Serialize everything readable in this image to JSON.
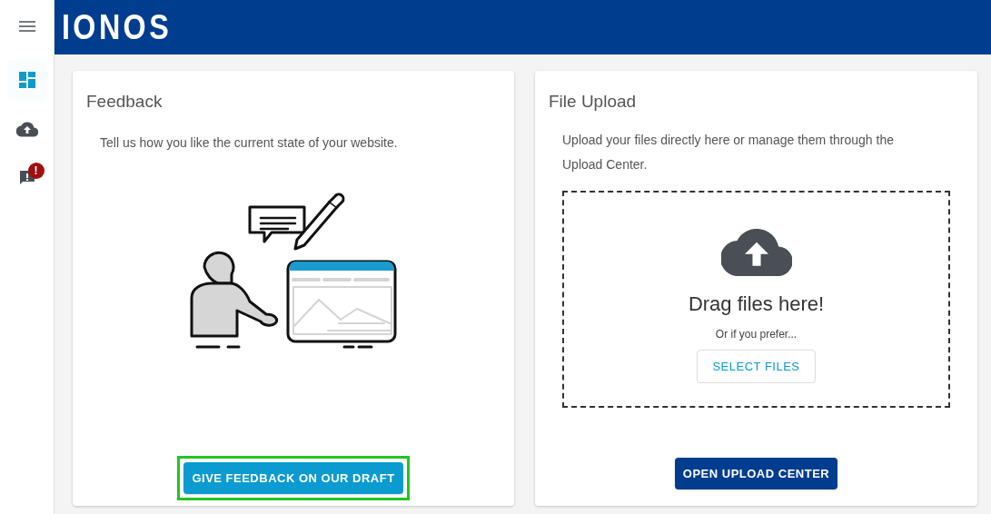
{
  "sidebar": {
    "items": [
      {
        "kind": "menu",
        "selected": false
      },
      {
        "kind": "dashboard",
        "selected": true
      },
      {
        "kind": "upload",
        "selected": false
      },
      {
        "kind": "feedback",
        "selected": false,
        "badge": "!"
      }
    ]
  },
  "header": {
    "logo": "IONOS"
  },
  "feedback_card": {
    "title": "Feedback",
    "text": "Tell us how you like the current state of your website.",
    "button": "GIVE FEEDBACK ON OUR DRAFT",
    "highlighted": true
  },
  "upload_card": {
    "title": "File Upload",
    "text": "Upload your files directly here or manage them through the Upload Center.",
    "dropzone": {
      "heading": "Drag files here!",
      "hint": "Or if you prefer...",
      "button": "SELECT FILES"
    },
    "button": "OPEN UPLOAD CENTER"
  }
}
